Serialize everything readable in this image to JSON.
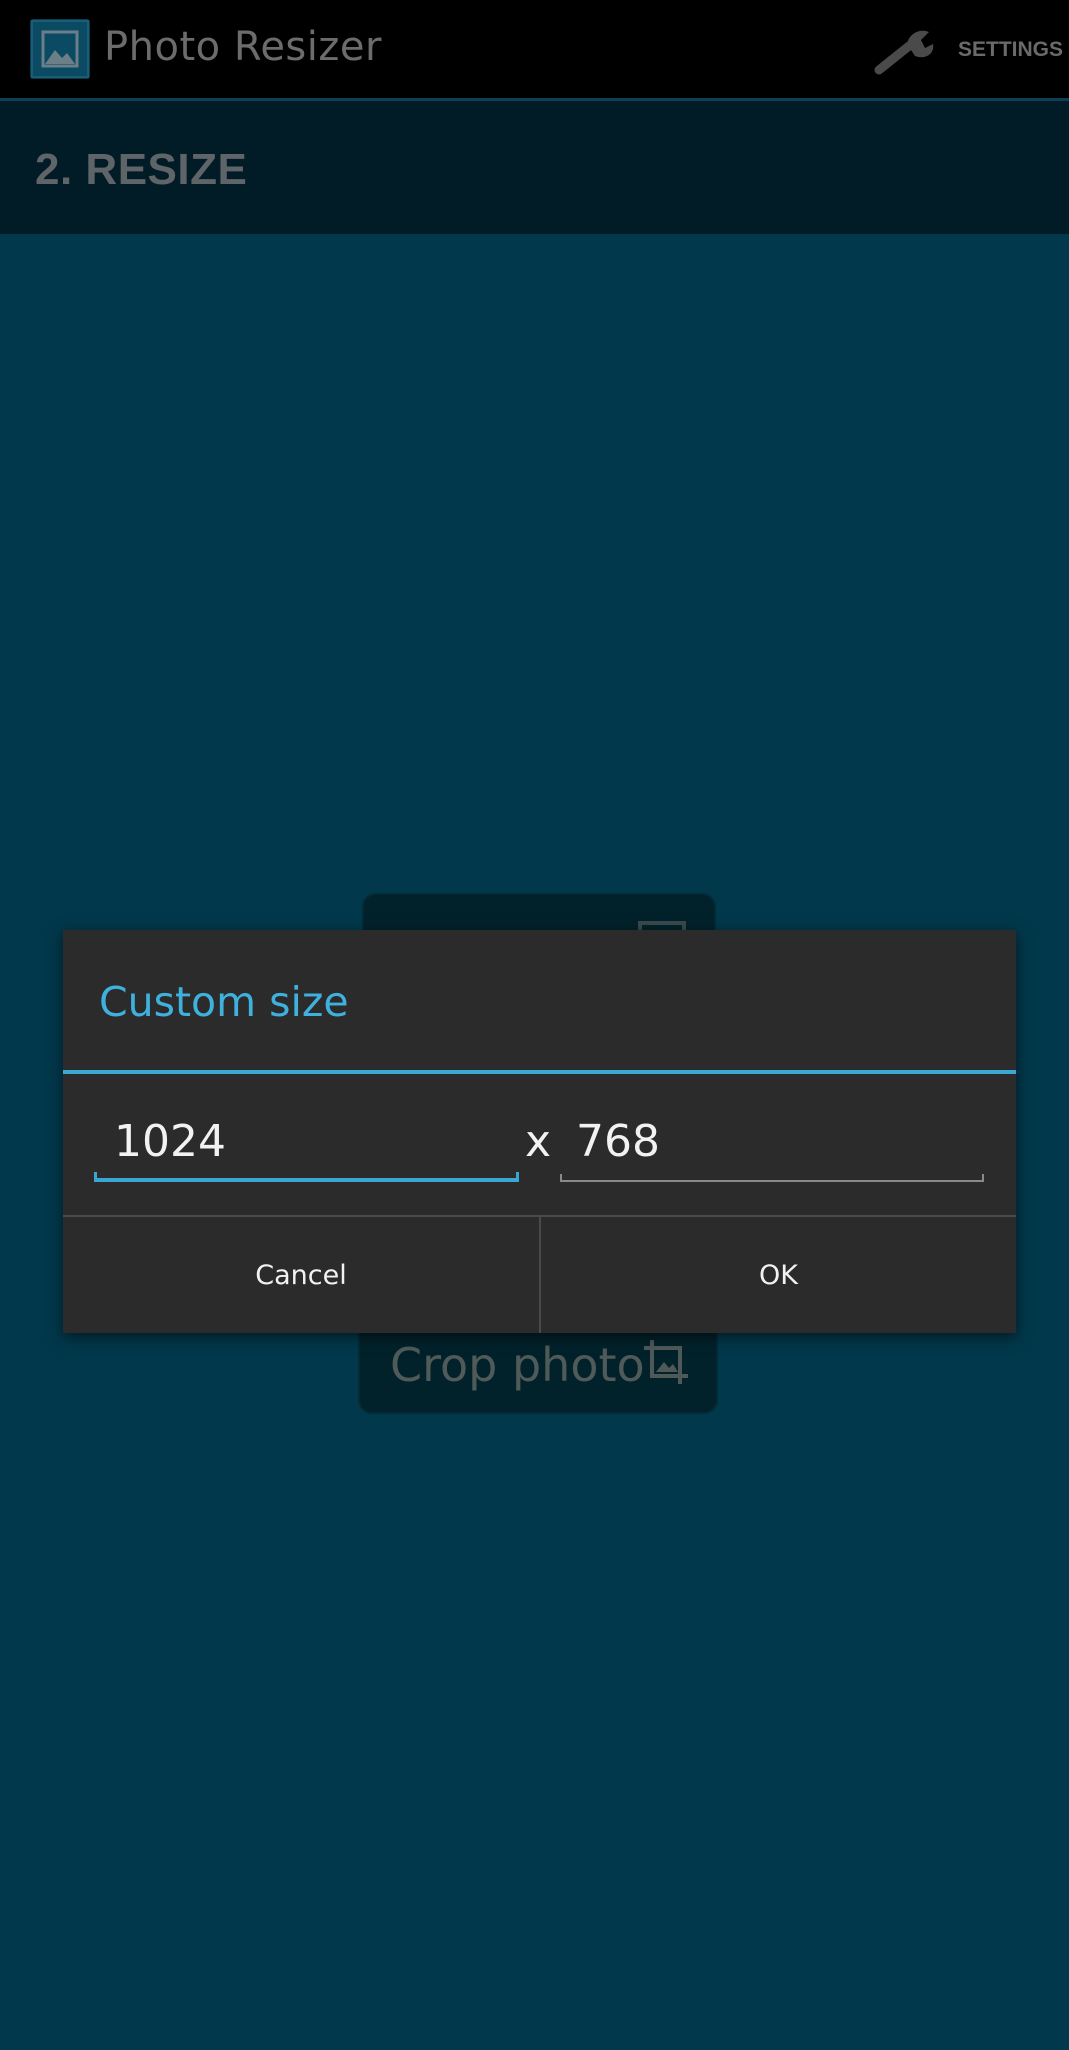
{
  "app": {
    "title": "Photo Resizer",
    "settings_label": "SETTINGS"
  },
  "section": {
    "title": "2. RESIZE"
  },
  "background": {
    "crop_button_label": "Crop photo"
  },
  "dialog": {
    "title": "Custom size",
    "width_value": "1024",
    "separator": "x",
    "height_value": "768",
    "cancel_label": "Cancel",
    "ok_label": "OK"
  },
  "colors": {
    "accent": "#3fb1dd",
    "background": "#02384b",
    "action_bar": "#000000",
    "dialog": "#2b2b2b"
  },
  "icons": {
    "app": "photo-icon",
    "settings": "wrench-icon",
    "crop": "crop-icon"
  }
}
